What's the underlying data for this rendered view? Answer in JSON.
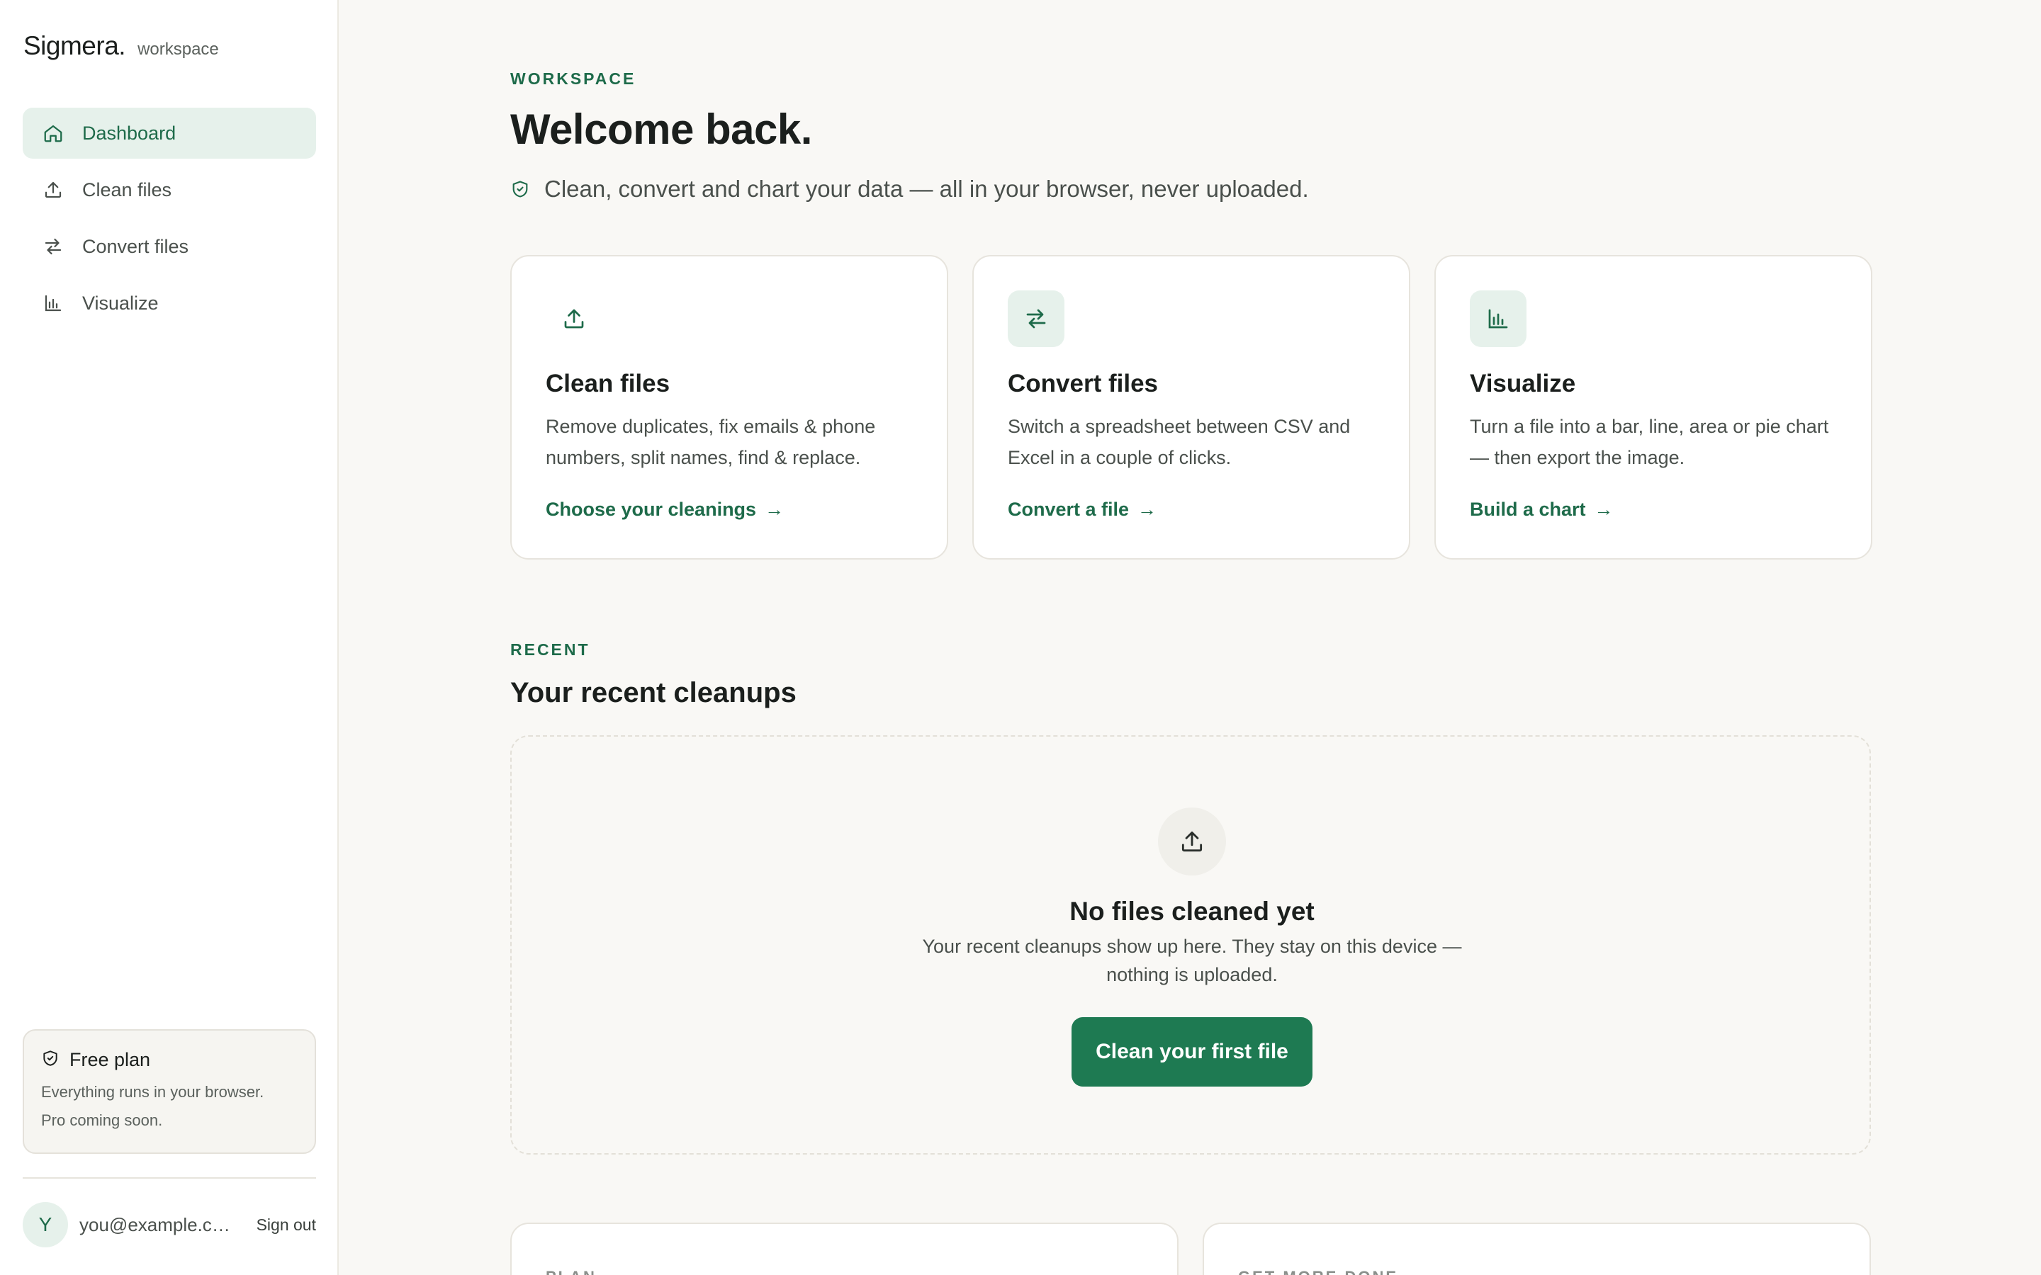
{
  "brand": {
    "name": "Sigmera.",
    "sub": "workspace"
  },
  "nav": [
    {
      "label": "Dashboard",
      "icon": "home-icon",
      "active": true
    },
    {
      "label": "Clean files",
      "icon": "upload-icon",
      "active": false
    },
    {
      "label": "Convert files",
      "icon": "swap-icon",
      "active": false
    },
    {
      "label": "Visualize",
      "icon": "bar-chart-icon",
      "active": false
    }
  ],
  "plan": {
    "title": "Free plan",
    "text1": "Everything runs in your browser.",
    "text2": "Pro coming soon."
  },
  "user": {
    "initial": "Y",
    "email": "you@example.com",
    "signout": "Sign out"
  },
  "header": {
    "eyebrow": "WORKSPACE",
    "title": "Welcome back.",
    "subtitle": "Clean, convert and chart your data — all in your browser, never uploaded."
  },
  "cards": [
    {
      "title": "Clean files",
      "desc": "Remove duplicates, fix emails & phone numbers, split names, find & replace.",
      "link": "Choose your cleanings",
      "icon": "upload-icon"
    },
    {
      "title": "Convert files",
      "desc": "Switch a spreadsheet between CSV and Excel in a couple of clicks.",
      "link": "Convert a file",
      "icon": "swap-icon"
    },
    {
      "title": "Visualize",
      "desc": "Turn a file into a bar, line, area or pie chart — then export the image.",
      "link": "Build a chart",
      "icon": "bar-chart-icon"
    }
  ],
  "recent": {
    "eyebrow": "RECENT",
    "title": "Your recent cleanups",
    "empty_title": "No files cleaned yet",
    "empty_text": "Your recent cleanups show up here. They stay on this device — nothing is uploaded.",
    "cta": "Clean your first file"
  },
  "bottom": {
    "left_label": "PLAN",
    "right_label": "GET MORE DONE"
  },
  "colors": {
    "accent": "#1e7a52",
    "accent_text": "#1e6b4a",
    "accent_tint": "#e6f1eb",
    "background": "#f9f8f5"
  },
  "arrow": "→"
}
